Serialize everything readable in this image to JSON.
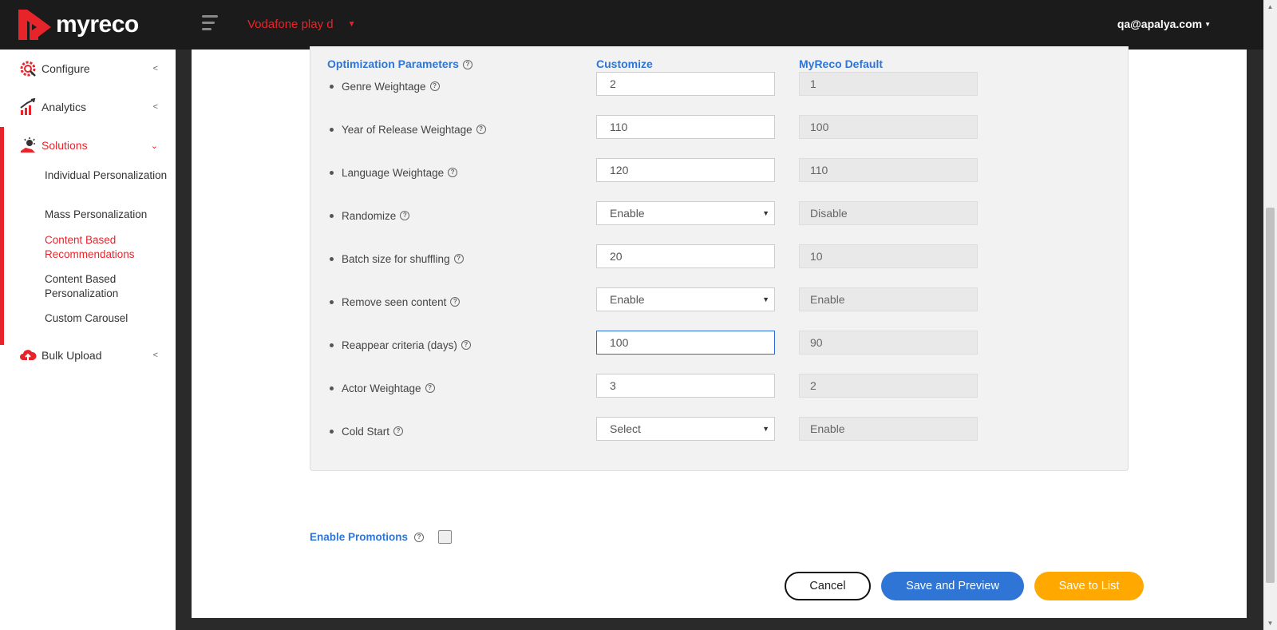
{
  "app": {
    "logo_text": "myreco"
  },
  "header": {
    "client": "Vodafone play d",
    "user": "qa@apalya.com"
  },
  "sidebar": {
    "items": [
      {
        "label": "Configure",
        "icon": "gear-icon"
      },
      {
        "label": "Analytics",
        "icon": "chart-icon"
      },
      {
        "label": "Solutions",
        "icon": "lightbulb-icon"
      },
      {
        "label": "Bulk Upload",
        "icon": "cloud-upload-icon"
      }
    ],
    "sub_items": [
      {
        "label": "Individual Personalization"
      },
      {
        "label": "Mass Personalization"
      },
      {
        "label": "Content Based Recommendations"
      },
      {
        "label": "Content Based Personalization"
      },
      {
        "label": "Custom Carousel"
      }
    ]
  },
  "columns": {
    "param": "Optimization Parameters",
    "customize": "Customize",
    "default": "MyReco Default"
  },
  "params": [
    {
      "label": "Genre Weightage",
      "value": "2",
      "default": "1",
      "type": "input"
    },
    {
      "label": "Year of Release Weightage",
      "value": "110",
      "default": "100",
      "type": "input"
    },
    {
      "label": "Language Weightage",
      "value": "120",
      "default": "110",
      "type": "input"
    },
    {
      "label": "Randomize",
      "value": "Enable",
      "default": "Disable",
      "type": "select"
    },
    {
      "label": "Batch size for shuffling",
      "value": "20",
      "default": "10",
      "type": "input"
    },
    {
      "label": "Remove seen content",
      "value": "Enable",
      "default": "Enable",
      "type": "select"
    },
    {
      "label": "Reappear criteria (days)",
      "value": "100",
      "default": "90",
      "type": "input"
    },
    {
      "label": "Actor Weightage",
      "value": "3",
      "default": "2",
      "type": "input"
    },
    {
      "label": "Cold Start",
      "value": "Select",
      "default": "Enable",
      "type": "select"
    }
  ],
  "promotions": {
    "label": "Enable Promotions",
    "checked": false
  },
  "buttons": {
    "cancel": "Cancel",
    "preview": "Save and Preview",
    "save": "Save to List"
  },
  "colors": {
    "brand_red": "#e8242b",
    "accent_blue": "#2e75d6",
    "save_orange": "#ffa800",
    "topbar": "#1b1b1b"
  }
}
